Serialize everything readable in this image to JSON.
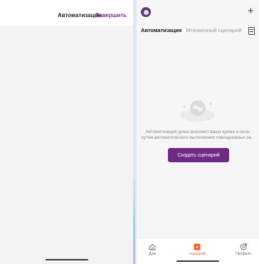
{
  "left_panel": {
    "title": "Автоматизация",
    "done_label": "Завершить"
  },
  "right_panel": {
    "tabs": [
      {
        "label": "Автоматизация",
        "active": true
      },
      {
        "label": "Мгновенный сценарий",
        "active": false
      }
    ],
    "empty_state": {
      "message": "Автоматизация дома экономит ваше время и силы путем автоматического выполнения повседневных за...",
      "create_button_label": "Создать сценарий"
    },
    "bottom_nav": [
      {
        "label": "Дом",
        "icon": "home-icon"
      },
      {
        "label": "Сценарий",
        "icon": "scene-icon",
        "active": true
      },
      {
        "label": "Профиль",
        "icon": "profile-icon"
      }
    ]
  },
  "colors": {
    "accent": "#6f2a83",
    "active_tab": "#ff5a1f"
  }
}
